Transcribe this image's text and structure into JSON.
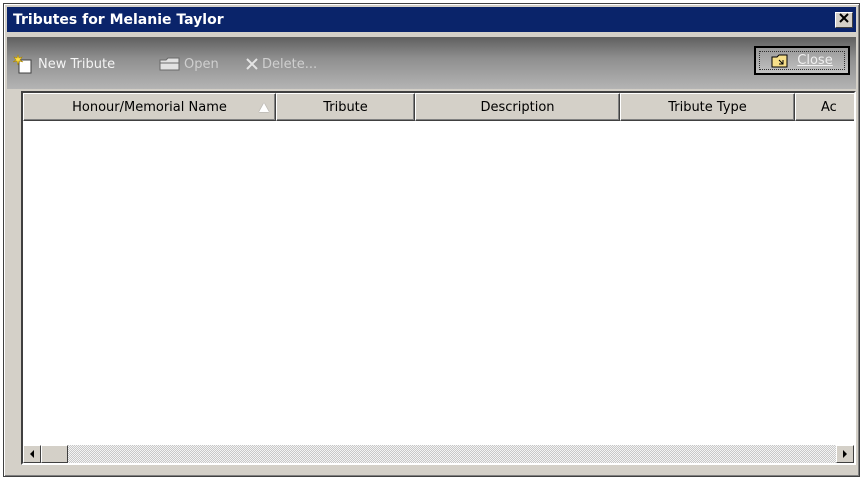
{
  "window": {
    "title": "Tributes for Melanie Taylor"
  },
  "toolbar": {
    "new_label": "New Tribute",
    "open_label": "Open",
    "delete_label": "Delete...",
    "close_label": "Close"
  },
  "grid": {
    "columns": [
      {
        "label": "Honour/Memorial Name",
        "sorted": "ascending"
      },
      {
        "label": "Tribute"
      },
      {
        "label": "Description"
      },
      {
        "label": "Tribute Type"
      },
      {
        "label": "Ac"
      }
    ],
    "rows": []
  },
  "icons": {
    "new": "new-tribute-icon",
    "open": "open-folder-icon",
    "delete": "delete-x-icon",
    "close": "close-folder-icon",
    "sort": "sort-ascending-icon",
    "scroll_left": "arrow-left-icon",
    "scroll_right": "arrow-right-icon"
  },
  "colors": {
    "titlebar": "#0a246a",
    "window_face": "#d4d0c8"
  }
}
